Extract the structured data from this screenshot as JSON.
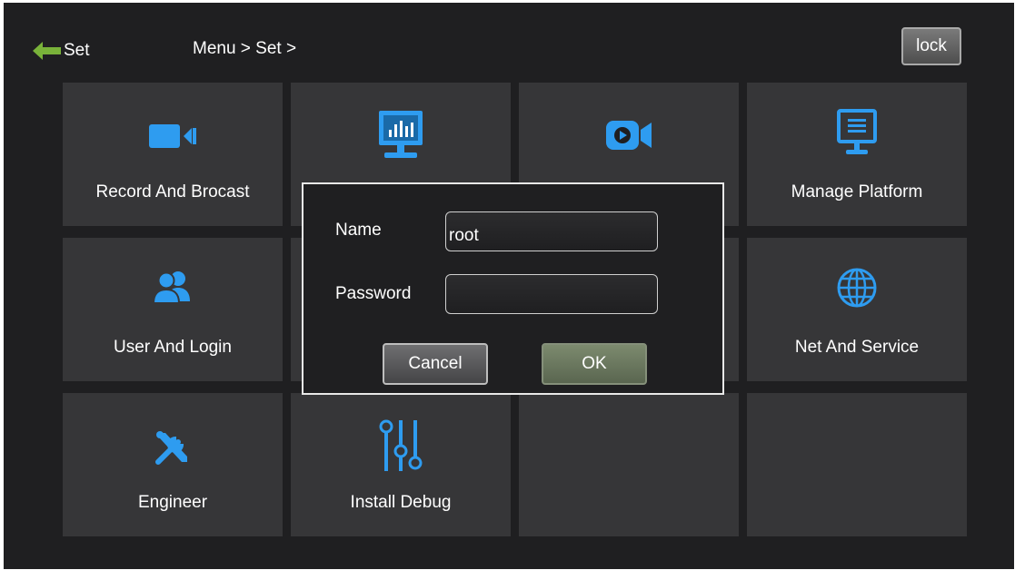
{
  "header": {
    "back_label": "Set",
    "breadcrumb": "Menu > Set >",
    "lock_label": "lock"
  },
  "tiles": [
    {
      "label": "Record And Brocast",
      "icon": "video-camera-icon"
    },
    {
      "label": "",
      "icon": "monitor-chart-icon"
    },
    {
      "label": "",
      "icon": "video-play-camera-icon"
    },
    {
      "label": "Manage Platform",
      "icon": "screen-menu-icon"
    },
    {
      "label": "User And Login",
      "icon": "users-icon"
    },
    {
      "label": "",
      "icon": ""
    },
    {
      "label": "",
      "icon": ""
    },
    {
      "label": "Net And Service",
      "icon": "globe-icon"
    },
    {
      "label": "Engineer",
      "icon": "tools-icon"
    },
    {
      "label": "Install Debug",
      "icon": "sliders-icon"
    },
    {
      "label": "",
      "icon": ""
    },
    {
      "label": "",
      "icon": ""
    }
  ],
  "dialog": {
    "name_label": "Name",
    "name_value": "root",
    "password_label": "Password",
    "password_value": "",
    "cancel_label": "Cancel",
    "ok_label": "OK"
  },
  "colors": {
    "accent_icon": "#2e9cf0",
    "back_arrow": "#79b23a",
    "tile_bg": "#363638",
    "screen_bg": "#1f1f21"
  }
}
